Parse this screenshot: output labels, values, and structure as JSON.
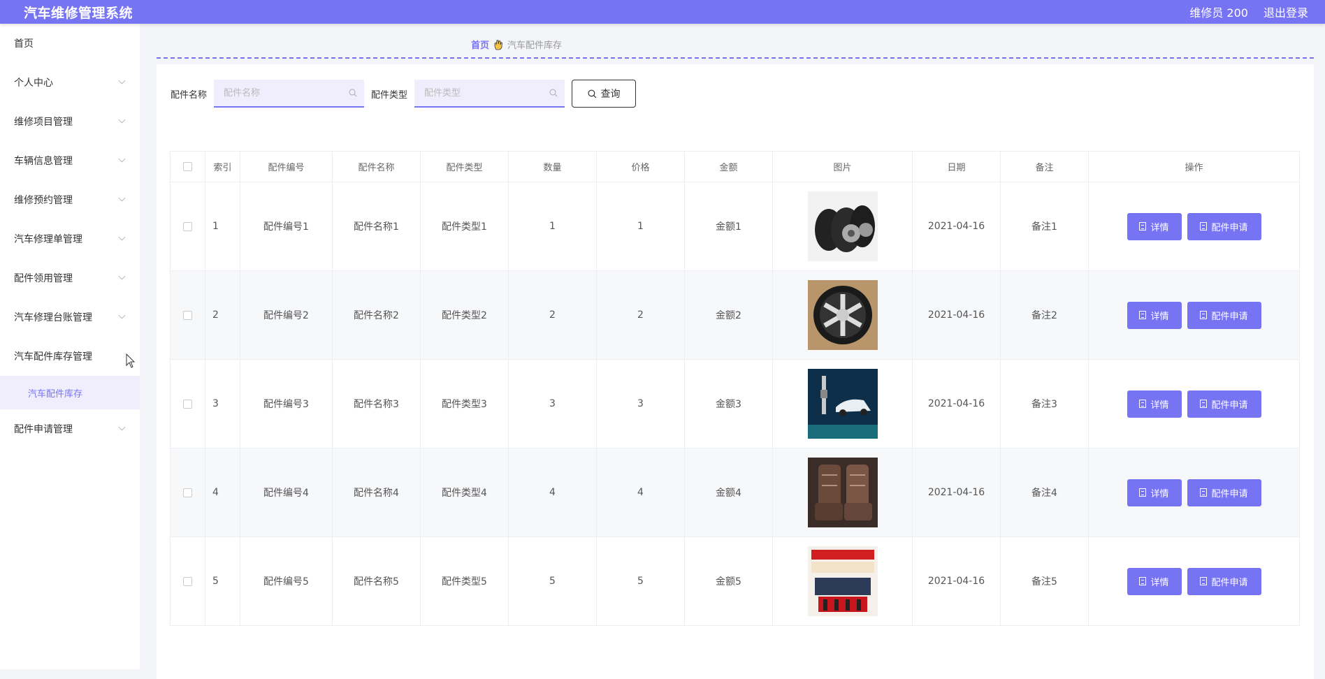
{
  "header": {
    "title": "汽车维修管理系统",
    "user": "维修员 200",
    "logout": "退出登录"
  },
  "sidebar": {
    "items": [
      {
        "label": "首页",
        "chevron": false
      },
      {
        "label": "个人中心",
        "chevron": true
      },
      {
        "label": "维修项目管理",
        "chevron": true
      },
      {
        "label": "车辆信息管理",
        "chevron": true
      },
      {
        "label": "维修预约管理",
        "chevron": true
      },
      {
        "label": "汽车修理单管理",
        "chevron": true
      },
      {
        "label": "配件领用管理",
        "chevron": true
      },
      {
        "label": "汽车修理台账管理",
        "chevron": true
      },
      {
        "label": "汽车配件库存管理",
        "chevron": false
      },
      {
        "label": "配件申请管理",
        "chevron": true
      }
    ],
    "submenu": {
      "label": "汽车配件库存"
    }
  },
  "breadcrumb": {
    "home": "首页",
    "current": "汽车配件库存"
  },
  "search": {
    "name_label": "配件名称",
    "name_placeholder": "配件名称",
    "type_label": "配件类型",
    "type_placeholder": "配件类型",
    "query_label": "查询"
  },
  "table": {
    "headers": [
      "索引",
      "配件编号",
      "配件名称",
      "配件类型",
      "数量",
      "价格",
      "金额",
      "图片",
      "日期",
      "备注",
      "操作"
    ],
    "detail_label": "详情",
    "apply_label": "配件申请",
    "rows": [
      {
        "index": "1",
        "code": "配件编号1",
        "name": "配件名称1",
        "type": "配件类型1",
        "qty": "1",
        "price": "1",
        "amount": "金额1",
        "image": "tires-photo",
        "date": "2021-04-16",
        "note": "备注1"
      },
      {
        "index": "2",
        "code": "配件编号2",
        "name": "配件名称2",
        "type": "配件类型2",
        "qty": "2",
        "price": "2",
        "amount": "金额2",
        "image": "wheel-rim-photo",
        "date": "2021-04-16",
        "note": "备注2"
      },
      {
        "index": "3",
        "code": "配件编号3",
        "name": "配件名称3",
        "type": "配件类型3",
        "qty": "3",
        "price": "3",
        "amount": "金额3",
        "image": "spark-plug-car-photo",
        "date": "2021-04-16",
        "note": "备注3"
      },
      {
        "index": "4",
        "code": "配件编号4",
        "name": "配件名称4",
        "type": "配件类型4",
        "qty": "4",
        "price": "4",
        "amount": "金额4",
        "image": "car-seat-photo",
        "date": "2021-04-16",
        "note": "备注4"
      },
      {
        "index": "5",
        "code": "配件编号5",
        "name": "配件名称5",
        "type": "配件类型5",
        "qty": "5",
        "price": "5",
        "amount": "金额5",
        "image": "fuel-additive-photo",
        "date": "2021-04-16",
        "note": "备注5"
      }
    ]
  },
  "colors": {
    "accent": "#7774f4",
    "submenu_bg": "#f0eefc"
  }
}
